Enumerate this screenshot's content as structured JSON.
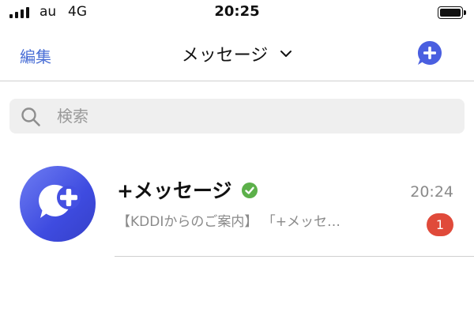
{
  "status_bar": {
    "carrier": "au",
    "network": "4G",
    "time": "20:25",
    "battery_level": 1.0
  },
  "nav": {
    "edit_label": "編集",
    "title": "メッセージ",
    "title_icon": "chevron-down-icon",
    "compose_icon": "compose-plus-icon"
  },
  "search": {
    "placeholder": "検索",
    "value": "",
    "icon": "search-icon"
  },
  "conversations": [
    {
      "sender": "+メッセージ",
      "verified": true,
      "time": "20:24",
      "preview": "【KDDIからのご案内】 「+メッセ…",
      "unread_count": "1"
    }
  ],
  "colors": {
    "accent": "#4a6fd6",
    "avatar_gradient_start": "#6e7df2",
    "avatar_gradient_end": "#3640c8",
    "verified_green": "#5cb04a",
    "badge_red": "#e04a3a",
    "secondary_text": "#8a8a8a",
    "search_bg": "#efefef"
  }
}
